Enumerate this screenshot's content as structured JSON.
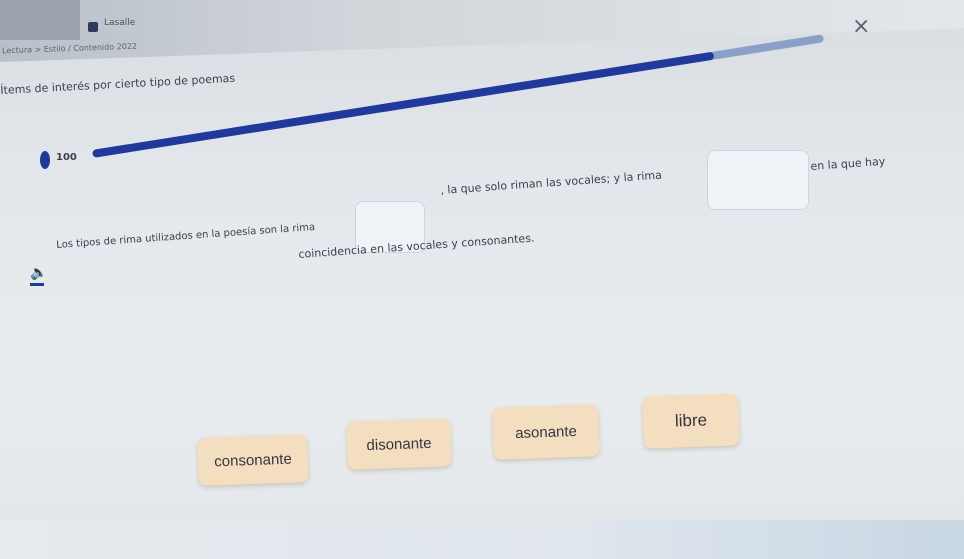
{
  "header": {
    "app_name": "Lasalle",
    "breadcrumb": "Lectura > Estilo / Contenido 2022",
    "prompt": "Ítems de interés por cierto tipo de poemas",
    "close_symbol": "×"
  },
  "progress": {
    "fraction": 0.85
  },
  "points": {
    "value": "100"
  },
  "exercise": {
    "part1": "Los tipos de rima utilizados en la poesía son la rima",
    "part2": ", la que solo riman las vocales; y la rima",
    "part3": "en la que hay",
    "part4": "coincidencia en las vocales y consonantes."
  },
  "options": [
    "consonante",
    "disonante",
    "asonante",
    "libre"
  ],
  "colors": {
    "accent": "#1f3a9c",
    "option_bg": "#f3dfbf",
    "blank_bg": "#eef3f7"
  }
}
